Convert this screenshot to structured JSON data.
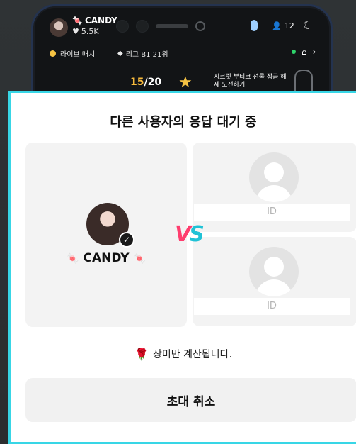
{
  "background": {
    "host": {
      "name": "CANDY",
      "likes": "5.5K"
    },
    "viewers": "12",
    "live_match": "라이브 매치",
    "league": "리그 B1 21위",
    "mission": {
      "current": "15",
      "total": "/20"
    },
    "promo": "시크릿 부티크 선물 잠금 해제 도전하기"
  },
  "modal": {
    "title": "다른 사용자의 응답 대기 중",
    "me": {
      "name": "CANDY"
    },
    "opponents": [
      {
        "id_label": "ID"
      },
      {
        "id_label": "ID"
      }
    ],
    "vs_v": "V",
    "vs_s": "S",
    "notice": "장미만 계산됩니다.",
    "cancel_label": "초대 취소"
  },
  "colors": {
    "accent_border": "#38d6e6",
    "vs_pink": "#ff3d6e",
    "vs_teal": "#1fc2d6"
  }
}
